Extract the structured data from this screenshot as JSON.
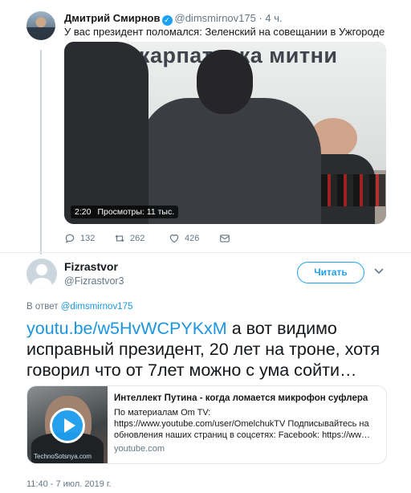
{
  "parent_tweet": {
    "author_name": "Дмитрий Смирнов",
    "author_handle": "@dimsmirnov175",
    "age": "4 ч.",
    "text": "У вас президент поломался: Зеленский  на совещании в Ужгороде",
    "video": {
      "sign_text": "Закарпатська митни",
      "duration": "2:20",
      "views": "Просмотры: 11 тыс."
    },
    "actions": {
      "replies": "132",
      "retweets": "262",
      "likes": "426"
    }
  },
  "tweet": {
    "author_name": "Fizrastvor",
    "author_handle": "@Fizrastvor3",
    "follow_label": "Читать",
    "in_reply_prefix": "В ответ ",
    "in_reply_handle": "@dimsmirnov175",
    "link_text": "youtu.be/w5HvWCPYKxM",
    "text": " а вот видимо исправный президент, 20 лет на троне, хотя говорил что от 7лет можно с ума сойти…",
    "card": {
      "title": "Интеллект Путина - когда ломается микрофон суфлера",
      "description": "По материалам Om TV: https://www.youtube.com/user/OmelchukTV Подписывайтесь на обновления наших страниц в соцсетях: Facebook: https://ww…",
      "domain": "youtube.com",
      "thumb_watermark": "TechnoSotsnya.com"
    },
    "timestamp": "11:40 - 7 июл. 2019 г."
  },
  "colors": {
    "accent": "#1da1f2",
    "link": "#1b95e0",
    "secondary_text": "#657786",
    "border": "#e6ecf0"
  },
  "icons": [
    "verified-icon",
    "reply-icon",
    "retweet-icon",
    "like-icon",
    "direct-message-icon",
    "chevron-down-icon",
    "play-icon"
  ]
}
